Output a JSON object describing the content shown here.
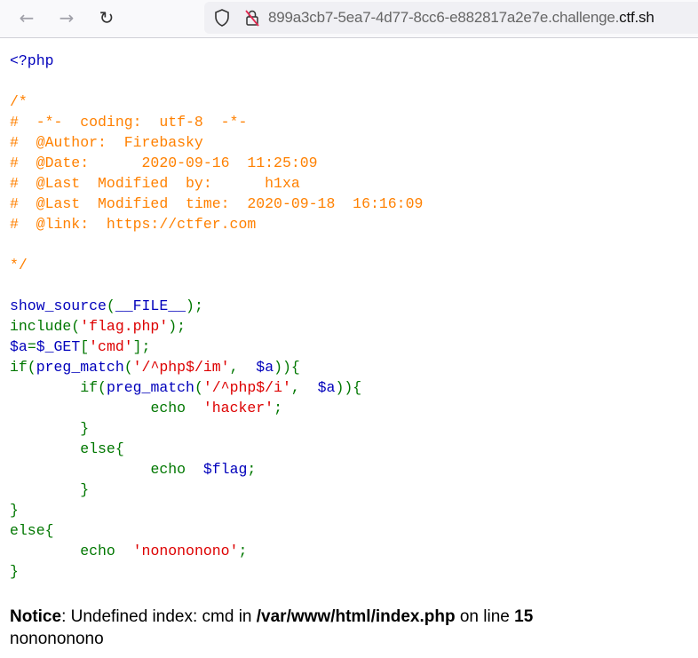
{
  "browser": {
    "back_icon": "arrow-left-icon",
    "forward_icon": "arrow-right-icon",
    "reload_icon": "reload-icon",
    "url_prefix": "899a3cb7-5ea7-4d77-8cc6-e882817a2e7e.challenge.",
    "url_domain": "ctf.sh"
  },
  "colors": {
    "default": "#0000BB",
    "keyword": "#007700",
    "string": "#DD0000",
    "comment": "#FF8000"
  },
  "code_lines": [
    [
      {
        "t": "<?php",
        "c": "default"
      }
    ],
    [],
    [
      {
        "t": "/*",
        "c": "comment"
      }
    ],
    [
      {
        "t": "#  -*-  coding:  utf-8  -*-",
        "c": "comment"
      }
    ],
    [
      {
        "t": "#  @Author:  Firebasky",
        "c": "comment"
      }
    ],
    [
      {
        "t": "#  @Date:      2020-09-16  11:25:09",
        "c": "comment"
      }
    ],
    [
      {
        "t": "#  @Last  Modified  by:      h1xa",
        "c": "comment"
      }
    ],
    [
      {
        "t": "#  @Last  Modified  time:  2020-09-18  16:16:09",
        "c": "comment"
      }
    ],
    [
      {
        "t": "#  @link:  https://ctfer.com",
        "c": "comment"
      }
    ],
    [],
    [
      {
        "t": "*/",
        "c": "comment"
      }
    ],
    [],
    [
      {
        "t": "show_source",
        "c": "default"
      },
      {
        "t": "(",
        "c": "keyword"
      },
      {
        "t": "__FILE__",
        "c": "default"
      },
      {
        "t": ");",
        "c": "keyword"
      }
    ],
    [
      {
        "t": "include(",
        "c": "keyword"
      },
      {
        "t": "'flag.php'",
        "c": "string"
      },
      {
        "t": ");",
        "c": "keyword"
      }
    ],
    [
      {
        "t": "$a",
        "c": "default"
      },
      {
        "t": "=",
        "c": "keyword"
      },
      {
        "t": "$_GET",
        "c": "default"
      },
      {
        "t": "[",
        "c": "keyword"
      },
      {
        "t": "'cmd'",
        "c": "string"
      },
      {
        "t": "];",
        "c": "keyword"
      }
    ],
    [
      {
        "t": "if(",
        "c": "keyword"
      },
      {
        "t": "preg_match",
        "c": "default"
      },
      {
        "t": "(",
        "c": "keyword"
      },
      {
        "t": "'/^php$/im'",
        "c": "string"
      },
      {
        "t": ",  ",
        "c": "keyword"
      },
      {
        "t": "$a",
        "c": "default"
      },
      {
        "t": ")){",
        "c": "keyword"
      }
    ],
    [
      {
        "t": "\tif(",
        "c": "keyword"
      },
      {
        "t": "preg_match",
        "c": "default"
      },
      {
        "t": "(",
        "c": "keyword"
      },
      {
        "t": "'/^php$/i'",
        "c": "string"
      },
      {
        "t": ",  ",
        "c": "keyword"
      },
      {
        "t": "$a",
        "c": "default"
      },
      {
        "t": ")){",
        "c": "keyword"
      }
    ],
    [
      {
        "t": "\t\techo  ",
        "c": "keyword"
      },
      {
        "t": "'hacker'",
        "c": "string"
      },
      {
        "t": ";",
        "c": "keyword"
      }
    ],
    [
      {
        "t": "\t}",
        "c": "keyword"
      }
    ],
    [
      {
        "t": "\telse{",
        "c": "keyword"
      }
    ],
    [
      {
        "t": "\t\techo  ",
        "c": "keyword"
      },
      {
        "t": "$flag",
        "c": "default"
      },
      {
        "t": ";",
        "c": "keyword"
      }
    ],
    [
      {
        "t": "\t}",
        "c": "keyword"
      }
    ],
    [
      {
        "t": "}",
        "c": "keyword"
      }
    ],
    [
      {
        "t": "else{",
        "c": "keyword"
      }
    ],
    [
      {
        "t": "\techo  ",
        "c": "keyword"
      },
      {
        "t": "'nonononono'",
        "c": "string"
      },
      {
        "t": ";",
        "c": "keyword"
      }
    ],
    [
      {
        "t": "}",
        "c": "keyword"
      }
    ]
  ],
  "notice": {
    "label": "Notice",
    "text1": ": Undefined index: cmd in ",
    "path": "/var/www/html/index.php",
    "text2": " on line ",
    "line": "15",
    "output": "nonononono"
  }
}
